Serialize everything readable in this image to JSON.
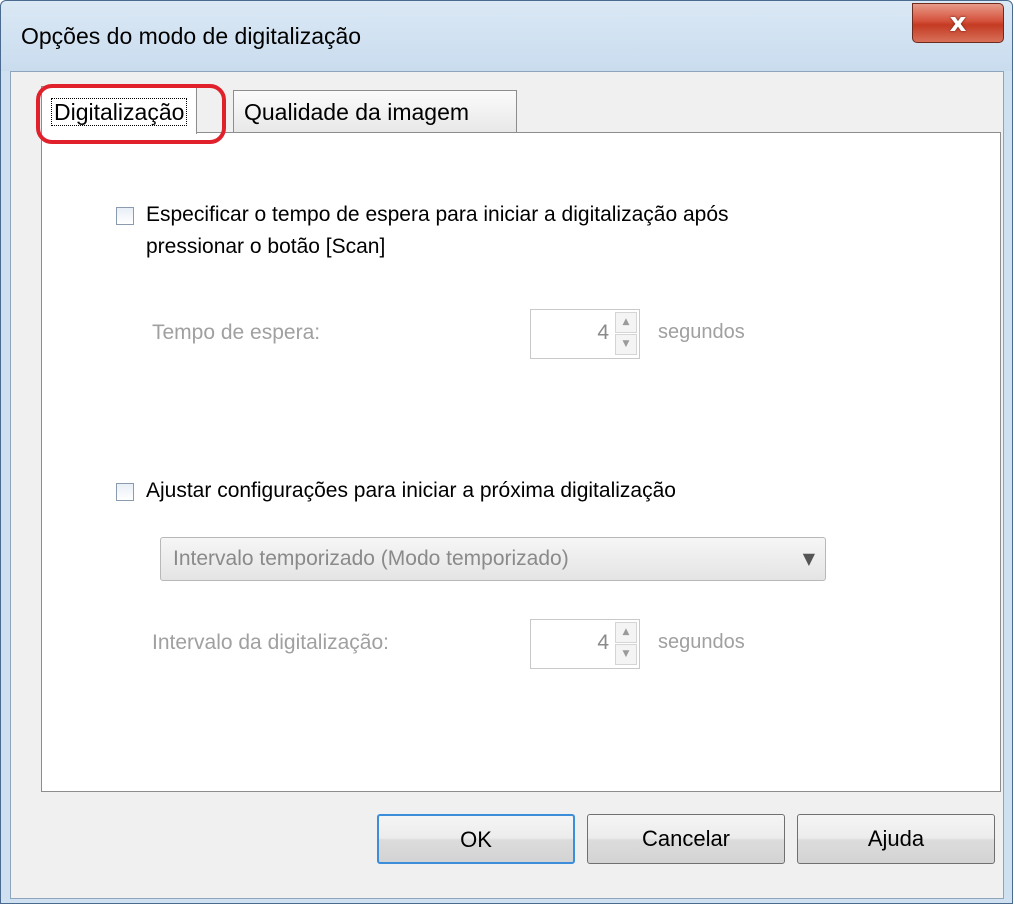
{
  "window": {
    "title": "Opções do modo de digitalização",
    "close_symbol": "x"
  },
  "tabs": [
    {
      "label": "Digitalização",
      "active": true
    },
    {
      "label": "Qualidade da imagem",
      "active": false
    }
  ],
  "scan_tab": {
    "wait_option": {
      "checked": false,
      "label_line1": "Especificar o tempo de espera para iniciar a digitalização após",
      "label_line2": "pressionar o botão [Scan]",
      "field_label": "Tempo de espera:",
      "value": "4",
      "unit": "segundos"
    },
    "next_scan_option": {
      "checked": false,
      "label": "Ajustar configurações para iniciar a próxima digitalização",
      "mode_selected": "Intervalo temporizado (Modo temporizado)",
      "field_label": "Intervalo da digitalização:",
      "value": "4",
      "unit": "segundos"
    }
  },
  "buttons": {
    "ok": "OK",
    "cancel": "Cancelar",
    "help": "Ajuda"
  },
  "icons": {
    "spin_up": "▲",
    "spin_down": "▼",
    "combo_arrow": "▼"
  },
  "colors": {
    "highlight": "#e0202a",
    "close_button": "#c43a22",
    "default_button_border": "#3c8edb"
  }
}
